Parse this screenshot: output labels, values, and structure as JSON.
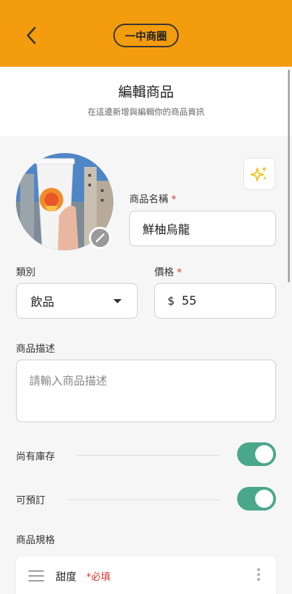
{
  "header": {
    "back_icon": "chevron-left-icon",
    "store_name": "一中商圈",
    "accent_color": "#f39c0d"
  },
  "page": {
    "title": "編輯商品",
    "subtitle": "在這邊新增與編輯你的商品資訊"
  },
  "form": {
    "ai_icon": "sparkles-icon",
    "edit_photo_icon": "pencil-icon",
    "name": {
      "label": "商品名稱",
      "required": "*",
      "value": "鮮柚烏龍"
    },
    "category": {
      "label": "類別",
      "value": "飲品"
    },
    "price": {
      "label": "價格",
      "required": "*",
      "currency": "$",
      "value": "55"
    },
    "description": {
      "label": "商品描述",
      "placeholder": "請輸入商品描述",
      "value": ""
    },
    "in_stock": {
      "label": "尚有庫存",
      "on": true
    },
    "preorder": {
      "label": "可預訂",
      "on": true
    },
    "toggle_color": "#4aa88a"
  },
  "specs": {
    "title": "商品規格",
    "items": [
      {
        "name": "甜度",
        "required": "*必填"
      }
    ]
  }
}
